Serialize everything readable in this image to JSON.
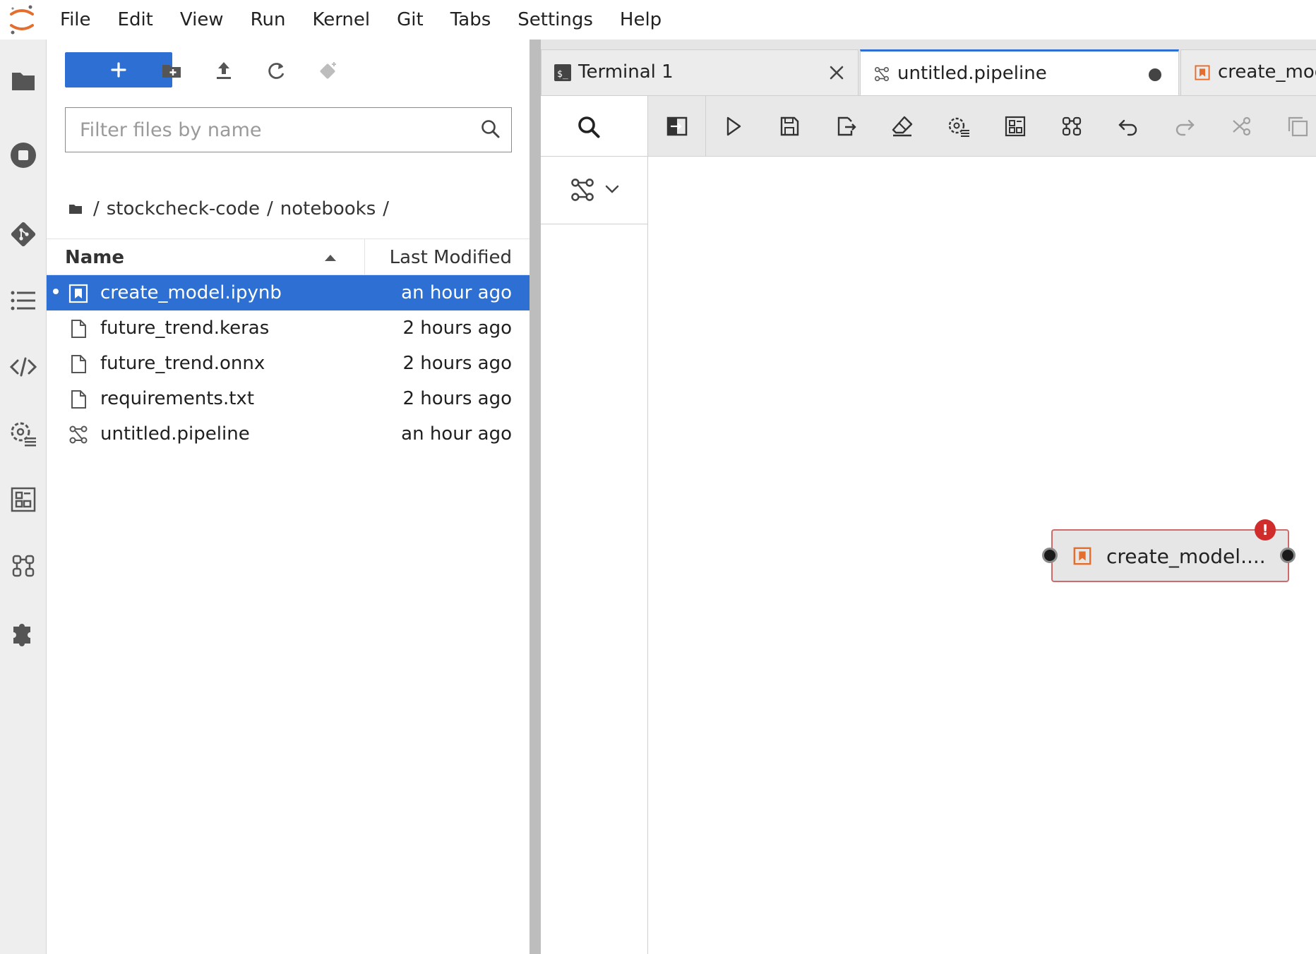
{
  "menubar": {
    "items": [
      {
        "label": "File"
      },
      {
        "label": "Edit"
      },
      {
        "label": "View"
      },
      {
        "label": "Run"
      },
      {
        "label": "Kernel"
      },
      {
        "label": "Git"
      },
      {
        "label": "Tabs"
      },
      {
        "label": "Settings"
      },
      {
        "label": "Help"
      }
    ]
  },
  "activity_bar": {
    "icons": [
      "folder-icon",
      "stop-circle-icon",
      "git-icon",
      "list-icon",
      "code-icon",
      "runtimes-icon",
      "component-catalog-icon",
      "pipeline-components-icon",
      "extension-icon"
    ]
  },
  "file_browser": {
    "new_button_icon": "plus-icon",
    "toolbar_icons": [
      "new-folder-icon",
      "upload-icon",
      "refresh-icon",
      "git-clone-icon"
    ],
    "filter": {
      "placeholder": "Filter files by name",
      "value": ""
    },
    "breadcrumb": {
      "separator": "/",
      "segments": [
        {
          "label": "stockcheck-code"
        },
        {
          "label": "notebooks"
        }
      ]
    },
    "columns": {
      "name": "Name",
      "modified": "Last Modified",
      "sort": "ascending"
    },
    "files": [
      {
        "name": "create_model.ipynb",
        "modified": "an hour ago",
        "type": "notebook",
        "selected": true
      },
      {
        "name": "future_trend.keras",
        "modified": "2 hours ago",
        "type": "file",
        "selected": false
      },
      {
        "name": "future_trend.onnx",
        "modified": "2 hours ago",
        "type": "file",
        "selected": false
      },
      {
        "name": "requirements.txt",
        "modified": "2 hours ago",
        "type": "file",
        "selected": false
      },
      {
        "name": "untitled.pipeline",
        "modified": "an hour ago",
        "type": "pipeline",
        "selected": false
      }
    ]
  },
  "tabs": [
    {
      "label": "Terminal 1",
      "icon": "terminal-icon",
      "active": false
    },
    {
      "label": "untitled.pipeline",
      "icon": "pipeline-icon",
      "active": true,
      "dirty": true
    },
    {
      "label": "create_mod",
      "icon": "notebook-icon",
      "active": false
    }
  ],
  "pipeline_toolbar": {
    "buttons": [
      "open-panel",
      "run-pipeline",
      "save-pipeline",
      "export-pipeline",
      "clear-pipeline",
      "runtimes",
      "component-catalogs",
      "arrange",
      "undo",
      "redo",
      "cut",
      "copy"
    ]
  },
  "pipeline": {
    "nodes": [
      {
        "label": "create_model....",
        "type": "notebook",
        "error_badge": "!"
      }
    ]
  },
  "colors": {
    "accent": "#2d6fd2",
    "selected_row_text": "#ffffff",
    "notebook_orange": "#e46e2e",
    "error": "#d12c2c",
    "node_border": "#cf6a6a"
  }
}
